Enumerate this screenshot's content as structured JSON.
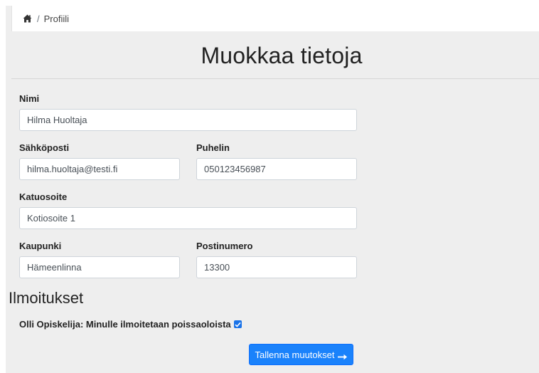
{
  "breadcrumb": {
    "home_icon": "home-icon",
    "separator": "/",
    "current": "Profiili"
  },
  "page": {
    "title": "Muokkaa tietoja"
  },
  "form": {
    "name": {
      "label": "Nimi",
      "value": "Hilma Huoltaja"
    },
    "email": {
      "label": "Sähköposti",
      "value": "hilma.huoltaja@testi.fi"
    },
    "phone": {
      "label": "Puhelin",
      "value": "050123456987"
    },
    "street": {
      "label": "Katuosoite",
      "value": "Kotiosoite 1"
    },
    "city": {
      "label": "Kaupunki",
      "value": "Hämeenlinna"
    },
    "postal": {
      "label": "Postinumero",
      "value": "13300"
    }
  },
  "notifications": {
    "title": "Ilmoitukset",
    "item_label": "Olli Opiskelija: Minulle ilmoitetaan poissaoloista",
    "item_checked": true
  },
  "actions": {
    "save_label": "Tallenna muutokset",
    "save_icon": "arrow-right-icon"
  },
  "colors": {
    "primary": "#1a82fb",
    "background": "#eeeeee"
  }
}
